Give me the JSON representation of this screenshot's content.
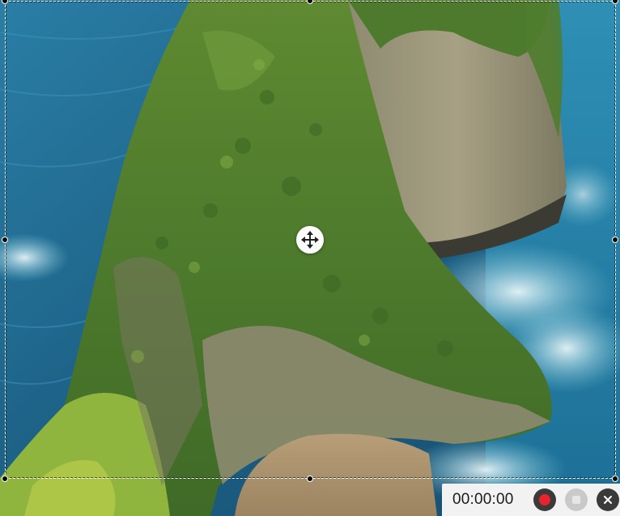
{
  "recorder": {
    "timer": "00:00:00",
    "buttons": {
      "record": {
        "icon": "record-icon",
        "color": "#e8232d"
      },
      "stop": {
        "icon": "stop-icon"
      },
      "close": {
        "icon": "close-icon"
      }
    }
  },
  "selection": {
    "move_icon": "move-arrows-icon"
  }
}
